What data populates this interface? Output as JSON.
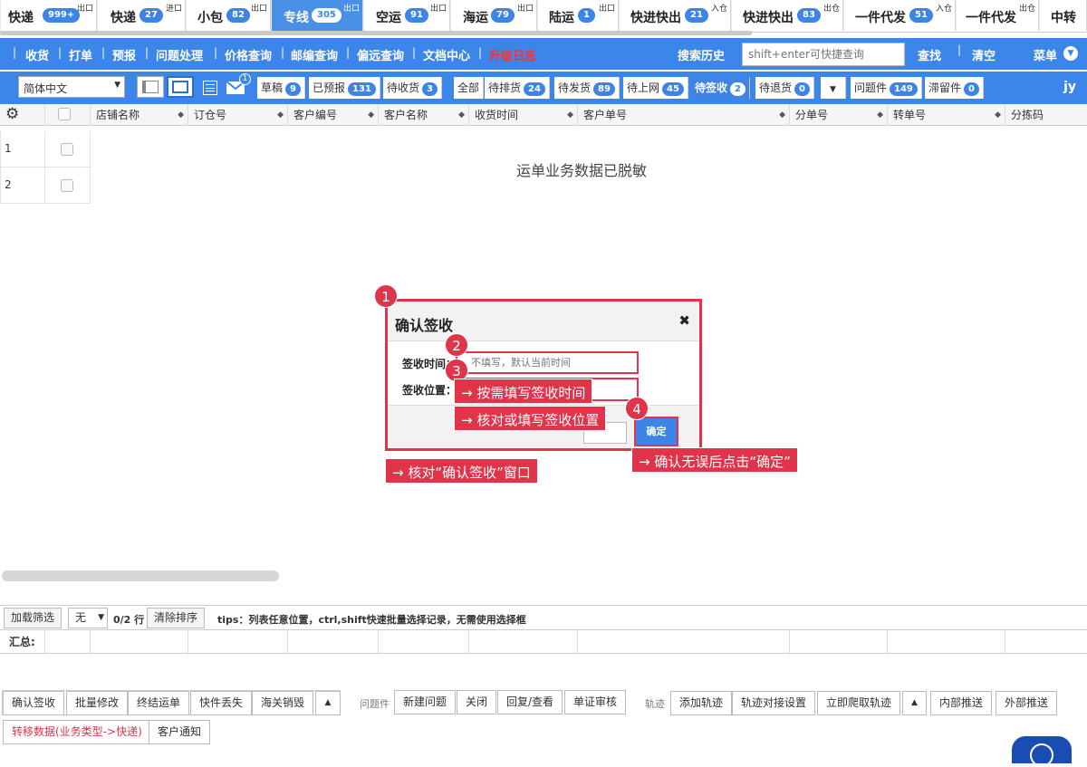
{
  "top_tabs": [
    {
      "label": "快递",
      "badge": "999+",
      "sup": "出口",
      "active": false
    },
    {
      "label": "快递",
      "badge": "27",
      "sup": "进口",
      "active": false
    },
    {
      "label": "小包",
      "badge": "82",
      "sup": "出口",
      "active": false
    },
    {
      "label": "专线",
      "badge": "305",
      "sup": "出口",
      "active": true
    },
    {
      "label": "空运",
      "badge": "91",
      "sup": "出口",
      "active": false
    },
    {
      "label": "海运",
      "badge": "79",
      "sup": "出口",
      "active": false
    },
    {
      "label": "陆运",
      "badge": "1",
      "sup": "出口",
      "active": false
    },
    {
      "label": "快进快出",
      "badge": "21",
      "sup": "入仓",
      "active": false
    },
    {
      "label": "快进快出",
      "badge": "83",
      "sup": "出仓",
      "active": false
    },
    {
      "label": "一件代发",
      "badge": "51",
      "sup": "入仓",
      "active": false
    },
    {
      "label": "一件代发",
      "badge": "",
      "sup": "出仓",
      "active": false
    },
    {
      "label": "中转",
      "badge": "",
      "sup": "",
      "active": false
    }
  ],
  "nav": {
    "items": [
      "收货",
      "打单",
      "预报",
      "问题处理",
      "价格查询",
      "邮编查询",
      "偏远查询",
      "文档中心"
    ],
    "upgrade": "升级日志",
    "search_history": "搜索历史",
    "search_placeholder": "shift+enter可快捷查询",
    "find": "查找",
    "clear": "清空",
    "menu": "菜单"
  },
  "toolbar": {
    "language": "简体中文",
    "mail_badge": "1",
    "status_tabs": [
      {
        "label": "草稿",
        "badge": "9",
        "active": false
      },
      {
        "label": "已预报",
        "badge": "131",
        "active": false
      },
      {
        "label": "待收货",
        "badge": "3",
        "active": false
      },
      {
        "label": "全部",
        "badge": "",
        "active": false
      },
      {
        "label": "待排货",
        "badge": "24",
        "active": false
      },
      {
        "label": "待发货",
        "badge": "89",
        "active": false
      },
      {
        "label": "待上网",
        "badge": "45",
        "active": false
      },
      {
        "label": "待签收",
        "badge": "2",
        "active": true
      },
      {
        "label": "待退货",
        "badge": "0",
        "active": false
      },
      {
        "label": "问题件",
        "badge": "149",
        "active": false
      },
      {
        "label": "滞留件",
        "badge": "0",
        "active": false
      }
    ],
    "user": "jy"
  },
  "grid": {
    "columns": [
      "店铺名称",
      "订仓号",
      "客户编号",
      "客户名称",
      "收货时间",
      "客户单号",
      "分单号",
      "转单号",
      "分拣码"
    ],
    "rows": [
      "1",
      "2"
    ],
    "masked_notice": "运单业务数据已脱敏"
  },
  "dialog": {
    "title": "确认签收",
    "close": "✖",
    "time_label": "签收时间：",
    "time_placeholder": "不填写，默认当前时间",
    "location_label": "签收位置：",
    "ok": "确定"
  },
  "annotations": {
    "m1": "1",
    "m2": "2",
    "m3": "3",
    "m4": "4",
    "c1": "→ 核对“确认签收”窗口",
    "c2": "→ 按需填写签收时间",
    "c3": "→ 核对或填写签收位置",
    "c4": "→ 确认无误后点击“确定”"
  },
  "bottom": {
    "load_filter": "加载筛选",
    "filter_value": "无",
    "row_count": "0/2 行",
    "clear_sort": "清除排序",
    "tips": "tips：列表任意位置，ctrl,shift快速批量选择记录，无需使用选择框",
    "summary": "汇总:",
    "actions1": [
      "确认签收",
      "批量修改",
      "终结运单",
      "快件丢失",
      "海关销毁"
    ],
    "issue_label": "问题件",
    "actions2": [
      "新建问题",
      "关闭",
      "回复/查看",
      "单证审核"
    ],
    "track_label": "轨迹",
    "actions3": [
      "添加轨迹",
      "轨迹对接设置",
      "立即爬取轨迹"
    ],
    "actions4": [
      "内部推送",
      "外部推送"
    ],
    "transfer": "转移数据(业务类型->快递)",
    "notify": "客户通知"
  }
}
